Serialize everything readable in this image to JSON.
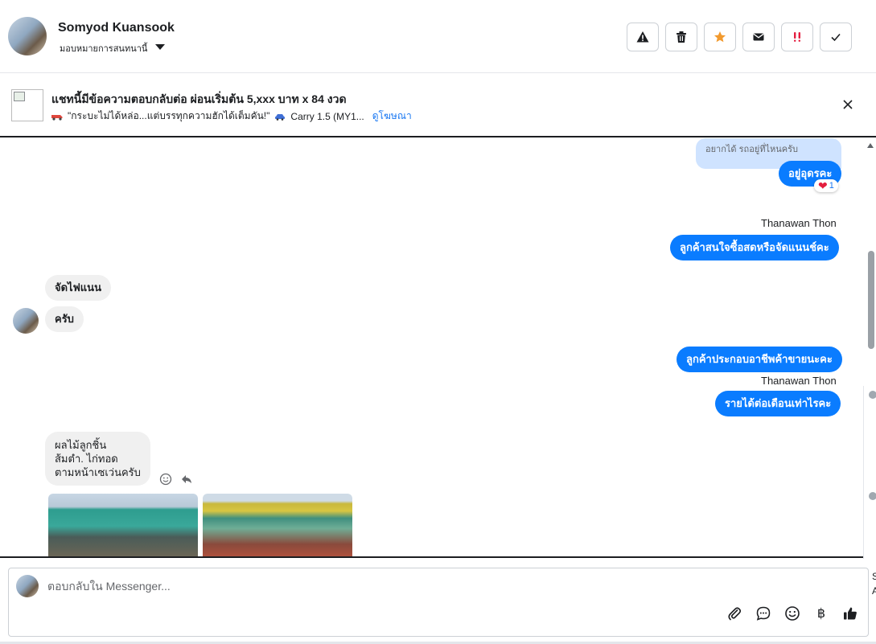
{
  "header": {
    "name": "Somyod Kuansook",
    "assign_label": "มอบหมายการสนทนานี้"
  },
  "ad": {
    "title": "แชทนี้มีข้อความตอบกลับต่อ ผ่อนเริ่มต้น 5,xxx บาท x 84 งวด",
    "snippet": "\"กระบะไม่ได้หล่อ...แต่บรรทุกความฮักได้เต็มคัน!\"",
    "model": "Carry 1.5 (MY1...",
    "link": "ดูโฆษณา"
  },
  "messages": {
    "quoted": "อยากได้ รถอยู่ที่ไหนครับ",
    "reply_location": "อยู่อุดรคะ",
    "reaction_count": "1",
    "sender1": "Thanawan Thon",
    "ask_cash": "ลูกค้าสนใจซื้อสดหรือจัดแนนช์คะ",
    "in_finance": "จัดไฟแนน",
    "in_yes": "ครับ",
    "ask_job": "ลูกค้าประกอบอาชีพค้าขายนะคะ",
    "sender2": "Thanawan Thon",
    "ask_income": "รายได้ต่อเดือนเท่าไรคะ",
    "in_answer_1": "ผลไม้ลูกชิ้น",
    "in_answer_2": "ส้มตำ. ไก่ทอด",
    "in_answer_3": "ตามหน้าเซเว่นครับ"
  },
  "composer": {
    "placeholder": "ตอบกลับใน Messenger...",
    "currency_symbol": "฿"
  },
  "edge": {
    "letter1": "S",
    "letter2": "A"
  }
}
